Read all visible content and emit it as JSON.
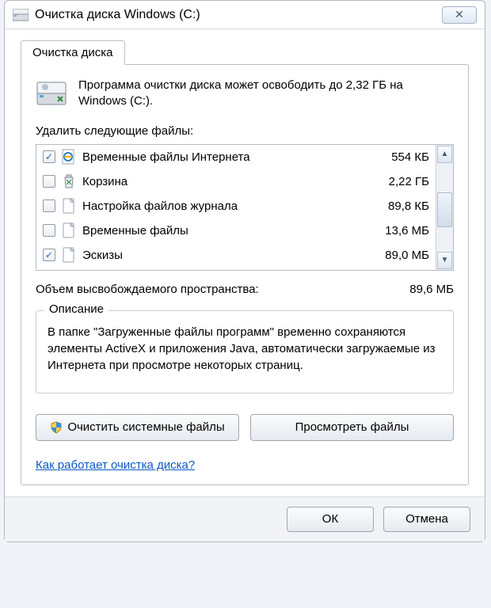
{
  "window": {
    "title": "Очистка диска Windows (C:)"
  },
  "tab": {
    "label": "Очистка диска"
  },
  "intro": {
    "text": "Программа очистки диска может освободить до 2,32 ГБ на Windows (C:)."
  },
  "delete_label": "Удалить следующие файлы:",
  "rows": [
    {
      "checked": true,
      "icon": "ie",
      "label": "Временные файлы Интернета",
      "size": "554 КБ"
    },
    {
      "checked": false,
      "icon": "bin",
      "label": "Корзина",
      "size": "2,22 ГБ"
    },
    {
      "checked": false,
      "icon": "file",
      "label": "Настройка файлов журнала",
      "size": "89,8 КБ"
    },
    {
      "checked": false,
      "icon": "file",
      "label": "Временные файлы",
      "size": "13,6 МБ"
    },
    {
      "checked": true,
      "icon": "file",
      "label": "Эскизы",
      "size": "89,0 МБ"
    }
  ],
  "freed": {
    "label": "Объем высвобождаемого пространства:",
    "value": "89,6 МБ"
  },
  "description": {
    "legend": "Описание",
    "text": "В папке \"Загруженные файлы программ\" временно сохраняются элементы ActiveX и приложения Java, автоматически загружаемые из Интернета при просмотре некоторых страниц."
  },
  "buttons": {
    "clean_system": "Очистить системные файлы",
    "view_files": "Просмотреть файлы"
  },
  "help_link": "Как работает очистка диска?",
  "bottom": {
    "ok": "ОК",
    "cancel": "Отмена"
  }
}
